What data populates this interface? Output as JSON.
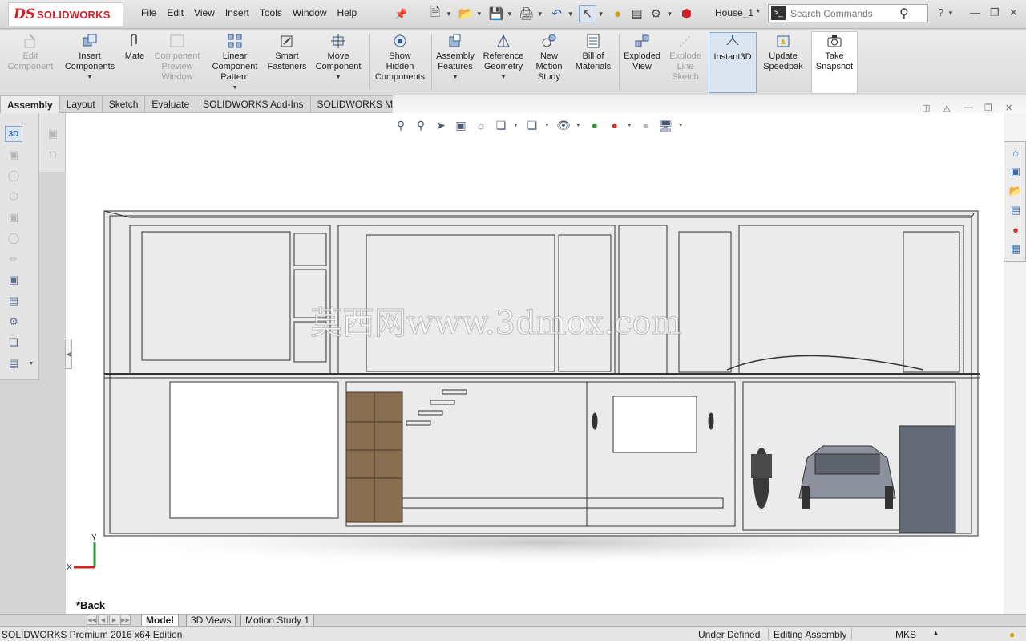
{
  "app": {
    "brand_prefix": "DS",
    "brand_name": "SOLIDWORKS",
    "document_title": "House_1 *",
    "accent_color": "#d31f26"
  },
  "menu": [
    "File",
    "Edit",
    "View",
    "Insert",
    "Tools",
    "Window",
    "Help"
  ],
  "search": {
    "placeholder": "Search Commands"
  },
  "quick_tools_icons": [
    "new-icon",
    "open-icon",
    "save-icon",
    "print-icon",
    "undo-icon",
    "select-icon",
    "rebuild-icon",
    "file-properties-icon",
    "options-icon"
  ],
  "command_manager": {
    "edit_component": "Edit\nComponent",
    "insert_components": "Insert\nComponents",
    "mate": "Mate",
    "component_preview": "Component\nPreview\nWindow",
    "linear_pattern": "Linear\nComponent\nPattern",
    "smart_fasteners": "Smart\nFasteners",
    "move_component": "Move\nComponent",
    "show_hidden": "Show\nHidden\nComponents",
    "assembly_features": "Assembly\nFeatures",
    "reference_geometry": "Reference\nGeometry",
    "new_motion_study": "New\nMotion\nStudy",
    "bill_of_materials": "Bill of\nMaterials",
    "exploded_view": "Exploded\nView",
    "explode_line_sketch": "Explode\nLine\nSketch",
    "instant3d": "Instant3D",
    "update_speedpak": "Update\nSpeedpak",
    "take_snapshot": "Take\nSnapshot"
  },
  "command_tabs": [
    "Assembly",
    "Layout",
    "Sketch",
    "Evaluate",
    "SOLIDWORKS Add-Ins",
    "SOLIDWORKS MBD"
  ],
  "active_command_tab": "Assembly",
  "viewport": {
    "view_name": "*Back",
    "watermark": "莫西网www.3dmox.com",
    "axis_y": "Y",
    "axis_x": "X"
  },
  "bottom_tabs": [
    "Model",
    "3D Views",
    "Motion Study 1"
  ],
  "active_bottom_tab": "Model",
  "status": {
    "edition": "SOLIDWORKS Premium 2016 x64 Edition",
    "definition": "Under Defined",
    "mode": "Editing Assembly",
    "units": "MKS"
  }
}
